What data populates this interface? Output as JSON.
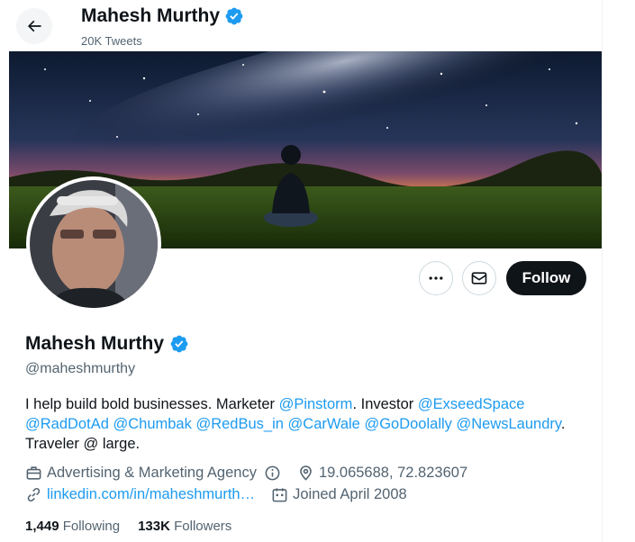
{
  "header": {
    "title": "Mahesh Murthy",
    "tweet_count": "20K Tweets"
  },
  "profile": {
    "name": "Mahesh Murthy",
    "handle": "@maheshmurthy",
    "bio": {
      "t1": "I help build bold businesses. Marketer ",
      "m1": "@Pinstorm",
      "t2": ". Investor ",
      "m2": "@ExseedSpace",
      "m3": "@RadDotAd",
      "m4": "@Chumbak",
      "m5": "@RedBus_in",
      "m6": "@CarWale",
      "m7": "@GoDoolally",
      "m8": "@NewsLaundry",
      "t3": ". Traveler @ large."
    },
    "category": "Advertising & Marketing Agency",
    "location": "19.065688, 72.823607",
    "website": "linkedin.com/in/maheshmurth…",
    "joined": "Joined April 2008"
  },
  "actions": {
    "follow_label": "Follow"
  },
  "stats": {
    "following_count": "1,449",
    "following_label": "Following",
    "followers_count": "133K",
    "followers_label": "Followers"
  },
  "colors": {
    "accent": "#1d9bf0",
    "text": "#0f1419",
    "secondary": "#536471"
  }
}
